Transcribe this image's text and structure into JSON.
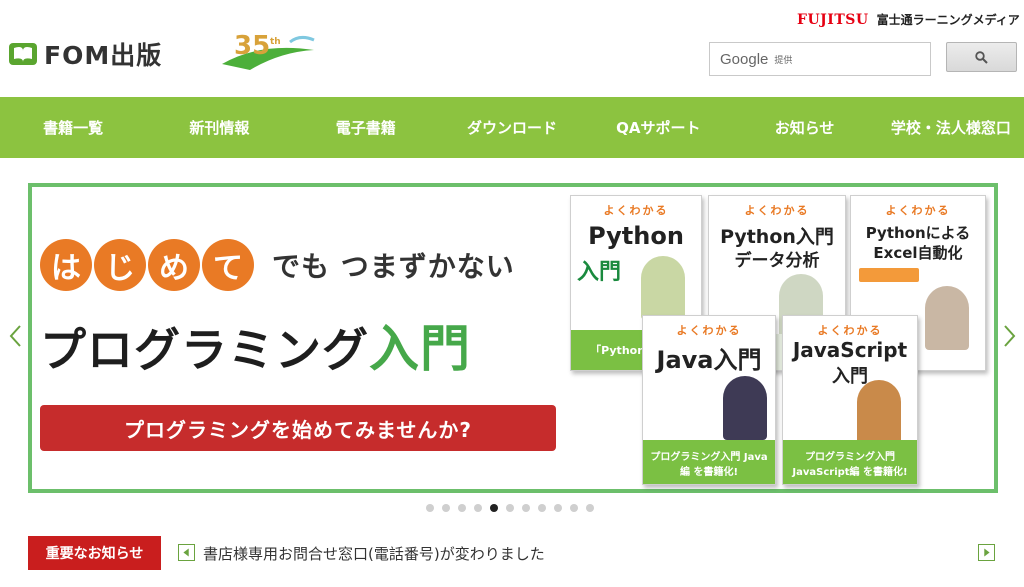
{
  "header": {
    "logo_text": "FOM出版",
    "anniversary_number": "35",
    "anniversary_suffix": "th",
    "fujitsu_logo": "FUJITSU",
    "company_name": "富士通ラーニングメディア",
    "search": {
      "brand": "Google",
      "placeholder": "提供"
    },
    "search_button_icon": "search-icon"
  },
  "nav": {
    "items": [
      "書籍一覧",
      "新刊情報",
      "電子書籍",
      "ダウンロード",
      "QAサポート",
      "お知らせ",
      "学校・法人様窓口"
    ]
  },
  "banner": {
    "circles": [
      "は",
      "じ",
      "め",
      "て"
    ],
    "subtitle": "でも つまずかない",
    "title_main": "プログラミング",
    "title_accent": "入門",
    "cta": "プログラミングを始めてみませんか?",
    "books": [
      {
        "series": "よくわかる",
        "title": "Python",
        "title2": "入門",
        "footer": "「Python 入門」"
      },
      {
        "series": "よくわかる",
        "title": "Python入門",
        "title2": "データ分析",
        "footer": ""
      },
      {
        "series": "よくわかる",
        "title": "Pythonによる",
        "title2": "Excel自動化",
        "footer": ""
      },
      {
        "series": "よくわかる",
        "title": "Java入門",
        "title2": "",
        "footer": "プログラミング入門 Java編 を書籍化!"
      },
      {
        "series": "よくわかる",
        "title": "JavaScript",
        "title2": "入門",
        "footer": "プログラミング入門 JavaScript編 を書籍化!"
      }
    ],
    "slide_count": 11,
    "active_slide": 5
  },
  "news": {
    "label": "重要なお知らせ",
    "text": "書店様専用お問合せ窓口(電話番号)が変わりました"
  },
  "colors": {
    "nav_green": "#8cc340",
    "banner_border": "#6cbf6b",
    "accent_orange": "#e97a25",
    "cta_red": "#c62c2c",
    "news_red": "#c91e1e"
  }
}
